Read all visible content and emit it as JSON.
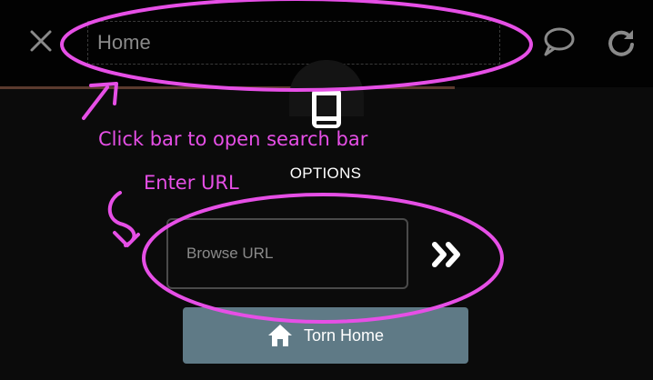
{
  "address_bar": {
    "text": "Home"
  },
  "options": {
    "label": "OPTIONS"
  },
  "url_input": {
    "placeholder": "Browse URL"
  },
  "home_button": {
    "label": "Torn Home"
  },
  "annotations": {
    "search_hint": "Click bar to open search bar",
    "url_hint": "Enter URL"
  },
  "colors": {
    "background": "#0b0b0b",
    "topbar": "#020202",
    "annotation": "#e64fe6",
    "home_button": "#5f7a86",
    "icon_gray": "#8a8a8a"
  }
}
